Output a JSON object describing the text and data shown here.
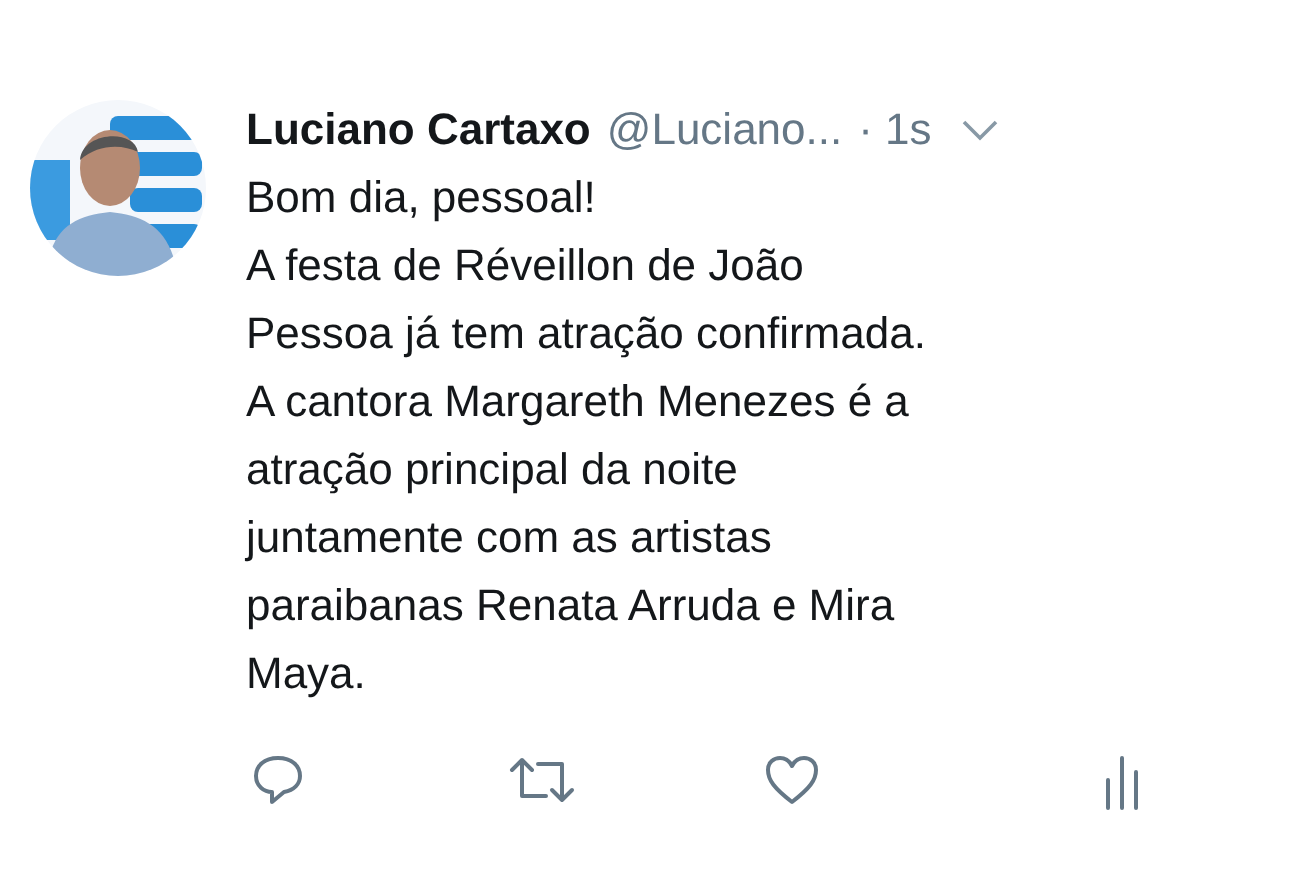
{
  "tweet": {
    "name": "Luciano Cartaxo",
    "handle": "@Luciano...",
    "time": "· 1s",
    "text": "Bom dia, pessoal!\nA festa de Réveillon de João\nPessoa já tem atração confirmada.\nA cantora Margareth Menezes é a\natração principal da noite\njuntamente com as artistas\nparaibanas Renata Arruda e Mira\nMaya.",
    "actions": [
      {
        "kind": "reply"
      },
      {
        "kind": "retweet"
      },
      {
        "kind": "like"
      },
      {
        "kind": "analytics"
      }
    ]
  }
}
